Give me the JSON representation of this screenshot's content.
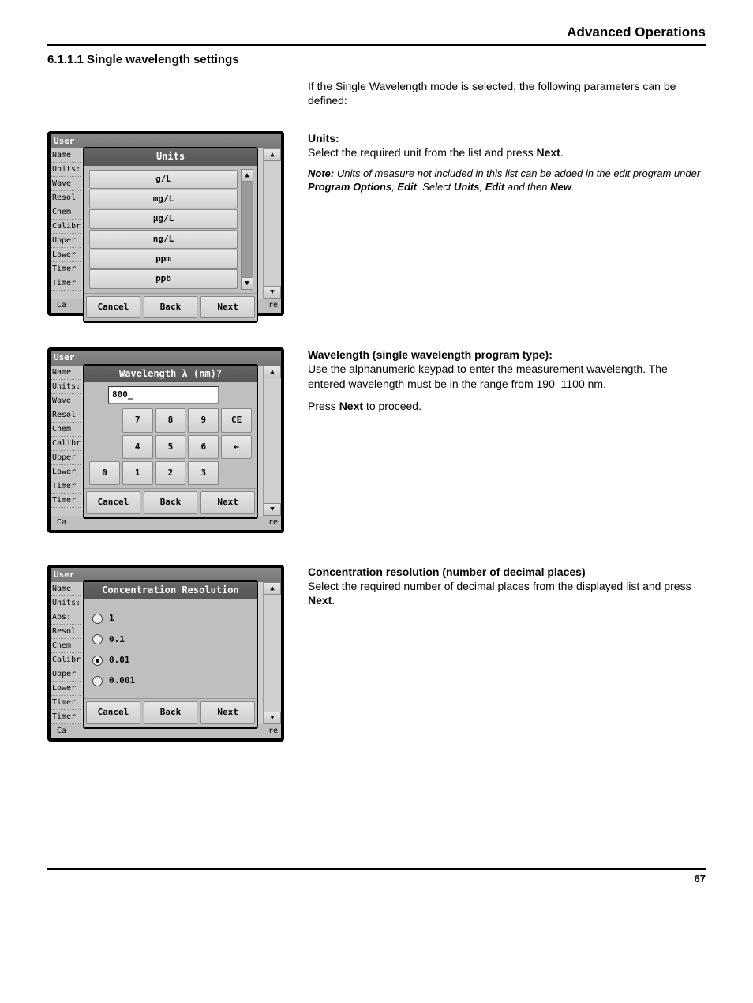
{
  "header": {
    "title": "Advanced Operations"
  },
  "section": {
    "heading": "6.1.1.1  Single wavelength settings"
  },
  "intro": "If the Single Wavelength mode is selected, the following parameters can be defined:",
  "units_block": {
    "title": "Units:",
    "body": "Select the required unit from the list and press ",
    "body_bold": "Next",
    "body_tail": ".",
    "note_prefix": "Note:",
    "note": " Units of measure not included in this list can be added in the edit program under ",
    "note_b1": "Program Options",
    "note_mid1": ", ",
    "note_b2": "Edit",
    "note_mid2": ". Select ",
    "note_b3": "Units",
    "note_mid3": ", ",
    "note_b4": "Edit",
    "note_mid4": " and then ",
    "note_b5": "New",
    "note_tail": "."
  },
  "panel_units": {
    "top": "User",
    "popup_title": "Units",
    "items": [
      "g/L",
      "mg/L",
      "µg/L",
      "ng/L",
      "ppm",
      "ppb"
    ],
    "cancel": "Cancel",
    "back": "Back",
    "next": "Next",
    "foot_left": "Ca",
    "foot_right": "re"
  },
  "side_labels": [
    "Name",
    "Units:",
    "Wave",
    "Resol",
    "Chem",
    "Calibr",
    "Upper",
    "Lower",
    "Timer",
    "Timer"
  ],
  "wave_block": {
    "title": "Wavelength (single wavelength program type):",
    "p1": "Use the alphanumeric keypad to enter the measurement wavelength. The entered wavelength must be in the range from 190–1100 nm.",
    "p2a": "Press ",
    "p2b": "Next",
    "p2c": " to proceed."
  },
  "panel_wave": {
    "top": "User",
    "popup_title": "Wavelength λ (nm)?",
    "input": "800_",
    "keys": [
      [
        "",
        "7",
        "8",
        "9",
        "CE"
      ],
      [
        "",
        "4",
        "5",
        "6",
        "←"
      ],
      [
        "0",
        "1",
        "2",
        "3",
        ""
      ]
    ],
    "cancel": "Cancel",
    "back": "Back",
    "next": "Next",
    "foot_left": "Ca",
    "foot_right": "re"
  },
  "conc_block": {
    "title": "Concentration resolution (number of decimal places)",
    "p1a": "Select the required number of decimal places from the displayed list and press ",
    "p1b": "Next",
    "p1c": "."
  },
  "panel_conc": {
    "top": "User",
    "popup_title": "Concentration Resolution",
    "options": [
      "1",
      "0.1",
      "0.01",
      "0.001"
    ],
    "selected_index": 2,
    "cancel": "Cancel",
    "back": "Back",
    "next": "Next",
    "foot_left": "Ca",
    "foot_right": "re"
  },
  "side_labels_conc": [
    "Name",
    "Units:",
    "Abs: I",
    "Resol",
    "Chem",
    "Calibr",
    "Upper",
    "Lower",
    "Timer",
    "Timer"
  ],
  "page_number": "67"
}
